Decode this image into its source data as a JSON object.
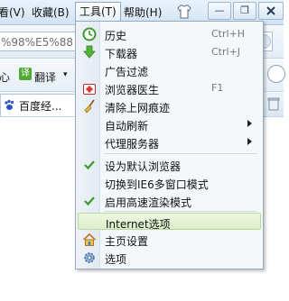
{
  "menubar": {
    "view": "看(V)",
    "favorites": "收藏(B)",
    "tools": "工具(T)",
    "help": "帮助(H)"
  },
  "window_buttons": {
    "minimize": "—",
    "restore": "❐"
  },
  "address": {
    "value": "%98%E5%88"
  },
  "toolbar": {
    "left_fragment": "心",
    "translate": "翻译",
    "right_fragment": "家"
  },
  "tab": {
    "title": "百度经..."
  },
  "menu": {
    "history": {
      "label": "历史",
      "shortcut": "Ctrl+H"
    },
    "downloads": {
      "label": "下载器",
      "shortcut": "Ctrl+J"
    },
    "adfilter": {
      "label": "广告过滤"
    },
    "doctor": {
      "label": "浏览器医生",
      "shortcut": "F1"
    },
    "clear": {
      "label": "清除上网痕迹"
    },
    "autorefresh": {
      "label": "自动刷新"
    },
    "proxy": {
      "label": "代理服务器"
    },
    "default": {
      "label": "设为默认浏览器"
    },
    "ie6": {
      "label": "切换到IE6多窗口模式"
    },
    "fastrender": {
      "label": "启用高速渲染模式"
    },
    "internet": {
      "label": "Internet选项"
    },
    "homepage": {
      "label": "主页设置"
    },
    "options": {
      "label": "选项"
    }
  },
  "colors": {
    "check": "#3c9b2e",
    "highlight": "#dcefc8",
    "menu_bg": "#f5f8fb"
  },
  "icons": {
    "history": "clock-icon",
    "downloads": "download-arrow-icon",
    "doctor": "first-aid-icon",
    "clear": "broom-icon",
    "homepage": "house-icon",
    "options": "gear-icon"
  }
}
